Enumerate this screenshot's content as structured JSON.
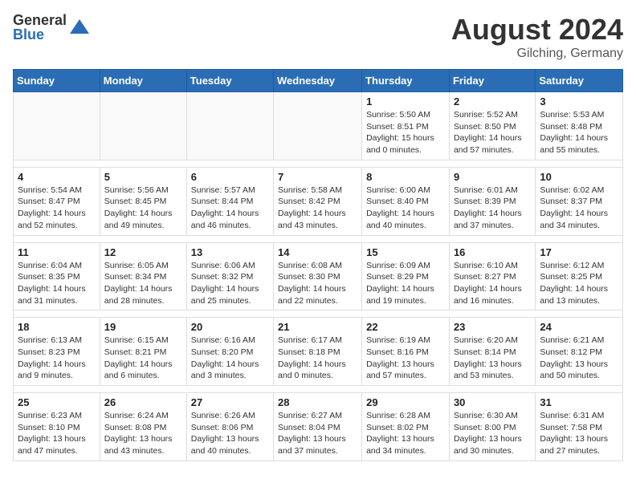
{
  "logo": {
    "general": "General",
    "blue": "Blue"
  },
  "header": {
    "month_year": "August 2024",
    "location": "Gilching, Germany"
  },
  "weekdays": [
    "Sunday",
    "Monday",
    "Tuesday",
    "Wednesday",
    "Thursday",
    "Friday",
    "Saturday"
  ],
  "weeks": [
    [
      {
        "day": "",
        "info": ""
      },
      {
        "day": "",
        "info": ""
      },
      {
        "day": "",
        "info": ""
      },
      {
        "day": "",
        "info": ""
      },
      {
        "day": "1",
        "info": "Sunrise: 5:50 AM\nSunset: 8:51 PM\nDaylight: 15 hours\nand 0 minutes."
      },
      {
        "day": "2",
        "info": "Sunrise: 5:52 AM\nSunset: 8:50 PM\nDaylight: 14 hours\nand 57 minutes."
      },
      {
        "day": "3",
        "info": "Sunrise: 5:53 AM\nSunset: 8:48 PM\nDaylight: 14 hours\nand 55 minutes."
      }
    ],
    [
      {
        "day": "4",
        "info": "Sunrise: 5:54 AM\nSunset: 8:47 PM\nDaylight: 14 hours\nand 52 minutes."
      },
      {
        "day": "5",
        "info": "Sunrise: 5:56 AM\nSunset: 8:45 PM\nDaylight: 14 hours\nand 49 minutes."
      },
      {
        "day": "6",
        "info": "Sunrise: 5:57 AM\nSunset: 8:44 PM\nDaylight: 14 hours\nand 46 minutes."
      },
      {
        "day": "7",
        "info": "Sunrise: 5:58 AM\nSunset: 8:42 PM\nDaylight: 14 hours\nand 43 minutes."
      },
      {
        "day": "8",
        "info": "Sunrise: 6:00 AM\nSunset: 8:40 PM\nDaylight: 14 hours\nand 40 minutes."
      },
      {
        "day": "9",
        "info": "Sunrise: 6:01 AM\nSunset: 8:39 PM\nDaylight: 14 hours\nand 37 minutes."
      },
      {
        "day": "10",
        "info": "Sunrise: 6:02 AM\nSunset: 8:37 PM\nDaylight: 14 hours\nand 34 minutes."
      }
    ],
    [
      {
        "day": "11",
        "info": "Sunrise: 6:04 AM\nSunset: 8:35 PM\nDaylight: 14 hours\nand 31 minutes."
      },
      {
        "day": "12",
        "info": "Sunrise: 6:05 AM\nSunset: 8:34 PM\nDaylight: 14 hours\nand 28 minutes."
      },
      {
        "day": "13",
        "info": "Sunrise: 6:06 AM\nSunset: 8:32 PM\nDaylight: 14 hours\nand 25 minutes."
      },
      {
        "day": "14",
        "info": "Sunrise: 6:08 AM\nSunset: 8:30 PM\nDaylight: 14 hours\nand 22 minutes."
      },
      {
        "day": "15",
        "info": "Sunrise: 6:09 AM\nSunset: 8:29 PM\nDaylight: 14 hours\nand 19 minutes."
      },
      {
        "day": "16",
        "info": "Sunrise: 6:10 AM\nSunset: 8:27 PM\nDaylight: 14 hours\nand 16 minutes."
      },
      {
        "day": "17",
        "info": "Sunrise: 6:12 AM\nSunset: 8:25 PM\nDaylight: 14 hours\nand 13 minutes."
      }
    ],
    [
      {
        "day": "18",
        "info": "Sunrise: 6:13 AM\nSunset: 8:23 PM\nDaylight: 14 hours\nand 9 minutes."
      },
      {
        "day": "19",
        "info": "Sunrise: 6:15 AM\nSunset: 8:21 PM\nDaylight: 14 hours\nand 6 minutes."
      },
      {
        "day": "20",
        "info": "Sunrise: 6:16 AM\nSunset: 8:20 PM\nDaylight: 14 hours\nand 3 minutes."
      },
      {
        "day": "21",
        "info": "Sunrise: 6:17 AM\nSunset: 8:18 PM\nDaylight: 14 hours\nand 0 minutes."
      },
      {
        "day": "22",
        "info": "Sunrise: 6:19 AM\nSunset: 8:16 PM\nDaylight: 13 hours\nand 57 minutes."
      },
      {
        "day": "23",
        "info": "Sunrise: 6:20 AM\nSunset: 8:14 PM\nDaylight: 13 hours\nand 53 minutes."
      },
      {
        "day": "24",
        "info": "Sunrise: 6:21 AM\nSunset: 8:12 PM\nDaylight: 13 hours\nand 50 minutes."
      }
    ],
    [
      {
        "day": "25",
        "info": "Sunrise: 6:23 AM\nSunset: 8:10 PM\nDaylight: 13 hours\nand 47 minutes."
      },
      {
        "day": "26",
        "info": "Sunrise: 6:24 AM\nSunset: 8:08 PM\nDaylight: 13 hours\nand 43 minutes."
      },
      {
        "day": "27",
        "info": "Sunrise: 6:26 AM\nSunset: 8:06 PM\nDaylight: 13 hours\nand 40 minutes."
      },
      {
        "day": "28",
        "info": "Sunrise: 6:27 AM\nSunset: 8:04 PM\nDaylight: 13 hours\nand 37 minutes."
      },
      {
        "day": "29",
        "info": "Sunrise: 6:28 AM\nSunset: 8:02 PM\nDaylight: 13 hours\nand 34 minutes."
      },
      {
        "day": "30",
        "info": "Sunrise: 6:30 AM\nSunset: 8:00 PM\nDaylight: 13 hours\nand 30 minutes."
      },
      {
        "day": "31",
        "info": "Sunrise: 6:31 AM\nSunset: 7:58 PM\nDaylight: 13 hours\nand 27 minutes."
      }
    ]
  ]
}
